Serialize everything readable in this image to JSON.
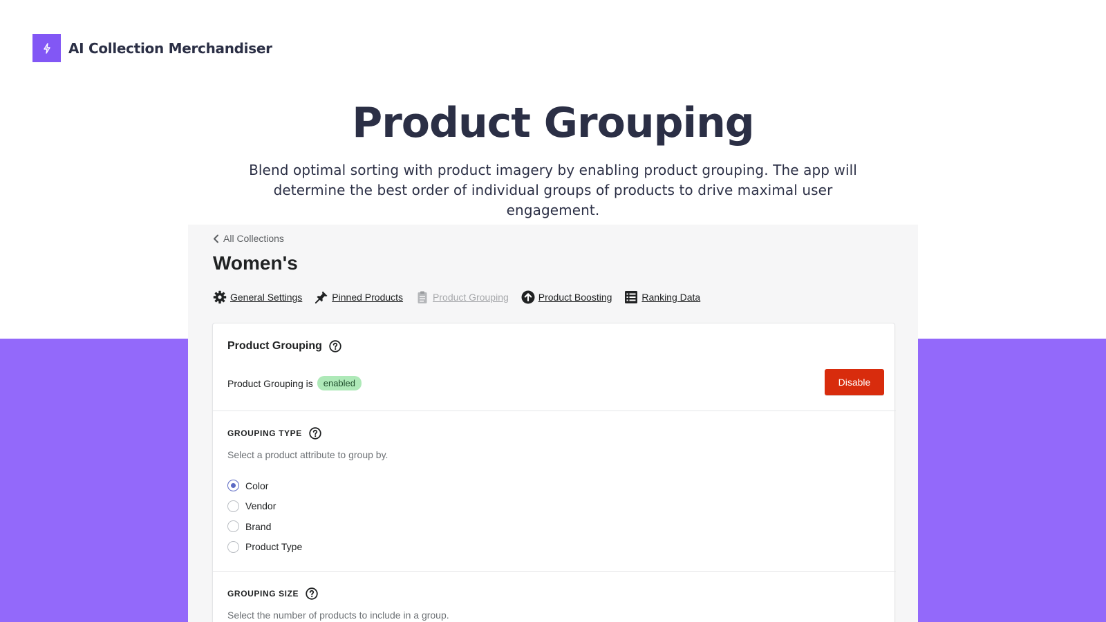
{
  "app": {
    "brand_name": "AI Collection Merchandiser",
    "brand_color": "#8257f5",
    "background_accent": "#9369fa"
  },
  "hero": {
    "title": "Product Grouping",
    "subtitle": "Blend optimal sorting with product imagery by enabling product grouping. The app will determine the best order of individual groups of products to drive maximal user engagement."
  },
  "panel": {
    "back_label": "All Collections",
    "collection_title": "Women's",
    "tabs": [
      {
        "label": "General Settings",
        "icon": "gear-icon",
        "active": true
      },
      {
        "label": "Pinned Products",
        "icon": "pin-icon",
        "active": true
      },
      {
        "label": "Product Grouping",
        "icon": "clipboard-icon",
        "active": false
      },
      {
        "label": "Product Boosting",
        "icon": "arrow-up-circle-icon",
        "active": true
      },
      {
        "label": "Ranking Data",
        "icon": "list-icon",
        "active": true
      }
    ]
  },
  "card": {
    "heading": "Product Grouping",
    "status_prefix": "Product Grouping is",
    "status_badge": "enabled",
    "disable_label": "Disable",
    "disable_color": "#d82c0d",
    "grouping_type": {
      "heading": "GROUPING TYPE",
      "description": "Select a product attribute to group by.",
      "options": [
        {
          "label": "Color",
          "selected": true
        },
        {
          "label": "Vendor",
          "selected": false
        },
        {
          "label": "Brand",
          "selected": false
        },
        {
          "label": "Product Type",
          "selected": false
        }
      ]
    },
    "grouping_size": {
      "heading": "GROUPING SIZE",
      "description": "Select the number of products to include in a group."
    }
  }
}
